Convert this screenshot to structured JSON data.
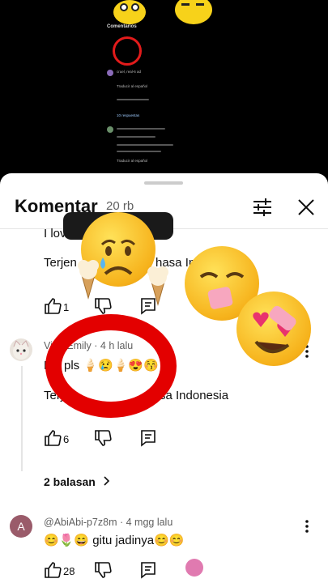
{
  "sheet": {
    "title": "Komentar",
    "count": "20 rb"
  },
  "comments": [
    {
      "text_partial": "I love t",
      "translate_left": "Terjen",
      "translate_right": "hasa In",
      "likes": "1"
    },
    {
      "author": "VirakEmily · 4 h lalu",
      "text": "Me pls 🍦😢🍦😍😚",
      "translate_left": "Terj",
      "translate_right": "sa Indonesia",
      "likes": "6",
      "replies_label": "2 balasan"
    },
    {
      "avatar_letter": "A",
      "author": "@AbiAbi-p7z8m · 4 mgg lalu",
      "text": "😊🌷😄 gitu jadinya😊😊",
      "likes": "28"
    }
  ],
  "mini_screen": {
    "title": "Comentarios",
    "lines": [
      "cruel, real-6 ad",
      "Traducir al español",
      "10 respuestas",
      "Traducir al español"
    ]
  },
  "colors": {
    "sheet_bg": "#ffffff",
    "text": "#0f0f0f",
    "meta": "#606060",
    "highlight_ring": "#e30000"
  }
}
